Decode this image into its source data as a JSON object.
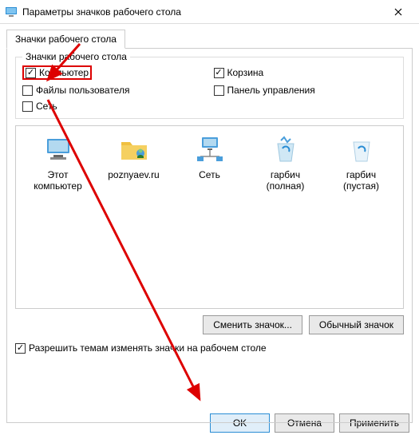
{
  "title": "Параметры значков рабочего стола",
  "tab_label": "Значки рабочего стола",
  "group_title": "Значки рабочего стола",
  "checks": {
    "computer": {
      "label": "Компьютер",
      "checked": true
    },
    "recycle": {
      "label": "Корзина",
      "checked": true
    },
    "userfiles": {
      "label": "Файлы пользователя",
      "checked": false
    },
    "controlpanel": {
      "label": "Панель управления",
      "checked": false
    },
    "network": {
      "label": "Сеть",
      "checked": false
    }
  },
  "icons": [
    {
      "id": "this-pc",
      "label": "Этот компьютер"
    },
    {
      "id": "user-folder",
      "label": "poznyaev.ru"
    },
    {
      "id": "network",
      "label": "Сеть"
    },
    {
      "id": "bin-full",
      "label": "гарбич (полная)"
    },
    {
      "id": "bin-empty",
      "label": "гарбич (пустая)"
    }
  ],
  "buttons": {
    "change_icon": "Сменить значок...",
    "default_icon": "Обычный значок",
    "allow_themes": "Разрешить темам изменять значки на рабочем столе",
    "ok": "OK",
    "cancel": "Отмена",
    "apply": "Применить"
  },
  "allow_themes_checked": true
}
